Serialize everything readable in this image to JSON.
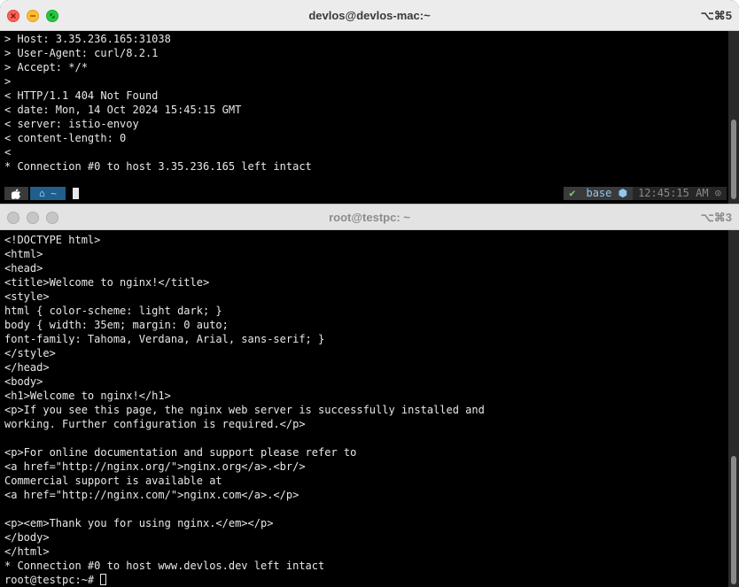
{
  "window1": {
    "title": "devlos@devlos-mac:~",
    "shortcut": "⌥⌘5",
    "lines": [
      "> Host: 3.35.236.165:31038",
      "> User-Agent: curl/8.2.1",
      "> Accept: */*",
      ">",
      "< HTTP/1.1 404 Not Found",
      "< date: Mon, 14 Oct 2024 15:45:15 GMT",
      "< server: istio-envoy",
      "< content-length: 0",
      "<",
      "* Connection #0 to host 3.35.236.165 left intact"
    ],
    "prompt": {
      "apple_icon": "",
      "home_segment": "⌂ ~",
      "status_check": "✔",
      "env": "base ⬢",
      "time": "12:45:15 AM ⊙"
    }
  },
  "window2": {
    "title": "root@testpc: ~",
    "shortcut": "⌥⌘3",
    "lines": [
      "<!DOCTYPE html>",
      "<html>",
      "<head>",
      "<title>Welcome to nginx!</title>",
      "<style>",
      "html { color-scheme: light dark; }",
      "body { width: 35em; margin: 0 auto;",
      "font-family: Tahoma, Verdana, Arial, sans-serif; }",
      "</style>",
      "</head>",
      "<body>",
      "<h1>Welcome to nginx!</h1>",
      "<p>If you see this page, the nginx web server is successfully installed and",
      "working. Further configuration is required.</p>",
      "",
      "<p>For online documentation and support please refer to",
      "<a href=\"http://nginx.org/\">nginx.org</a>.<br/>",
      "Commercial support is available at",
      "<a href=\"http://nginx.com/\">nginx.com</a>.</p>",
      "",
      "<p><em>Thank you for using nginx.</em></p>",
      "</body>",
      "</html>",
      "* Connection #0 to host www.devlos.dev left intact"
    ],
    "prompt": "root@testpc:~# "
  }
}
